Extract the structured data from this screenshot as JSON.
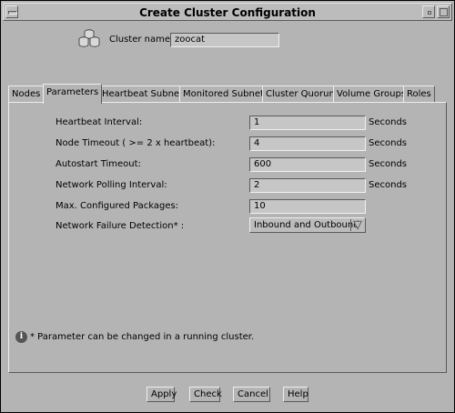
{
  "window": {
    "title": "Create Cluster Configuration"
  },
  "header": {
    "cluster_name_label": "Cluster name:",
    "cluster_name_value": "zoocat"
  },
  "tabs": [
    {
      "label": "Nodes",
      "active": false
    },
    {
      "label": "Parameters",
      "active": true
    },
    {
      "label": "Heartbeat Subnets",
      "active": false
    },
    {
      "label": "Monitored Subnets",
      "active": false
    },
    {
      "label": "Cluster Quorum",
      "active": false
    },
    {
      "label": "Volume Groups",
      "active": false
    },
    {
      "label": "Roles",
      "active": false
    }
  ],
  "parameters": {
    "heartbeat_interval": {
      "label": "Heartbeat Interval:",
      "value": "1",
      "unit": "Seconds"
    },
    "node_timeout": {
      "label": "Node Timeout ( >= 2 x heartbeat):",
      "value": "4",
      "unit": "Seconds"
    },
    "autostart_timeout": {
      "label": "Autostart Timeout:",
      "value": "600",
      "unit": "Seconds"
    },
    "network_polling_interval": {
      "label": "Network Polling Interval:",
      "value": "2",
      "unit": "Seconds"
    },
    "max_configured_packages": {
      "label": "Max. Configured Packages:",
      "value": "10"
    },
    "network_failure_detection": {
      "label": "Network Failure Detection* :",
      "value": "Inbound and Outbound"
    }
  },
  "footnote": "* Parameter can be changed in a running cluster.",
  "buttons": {
    "apply": "Apply",
    "check": "Check",
    "cancel": "Cancel",
    "help": "Help"
  },
  "icons": {
    "cluster": "cluster-icon",
    "info": "info-icon",
    "dropdown": "dropdown-arrow-icon"
  }
}
